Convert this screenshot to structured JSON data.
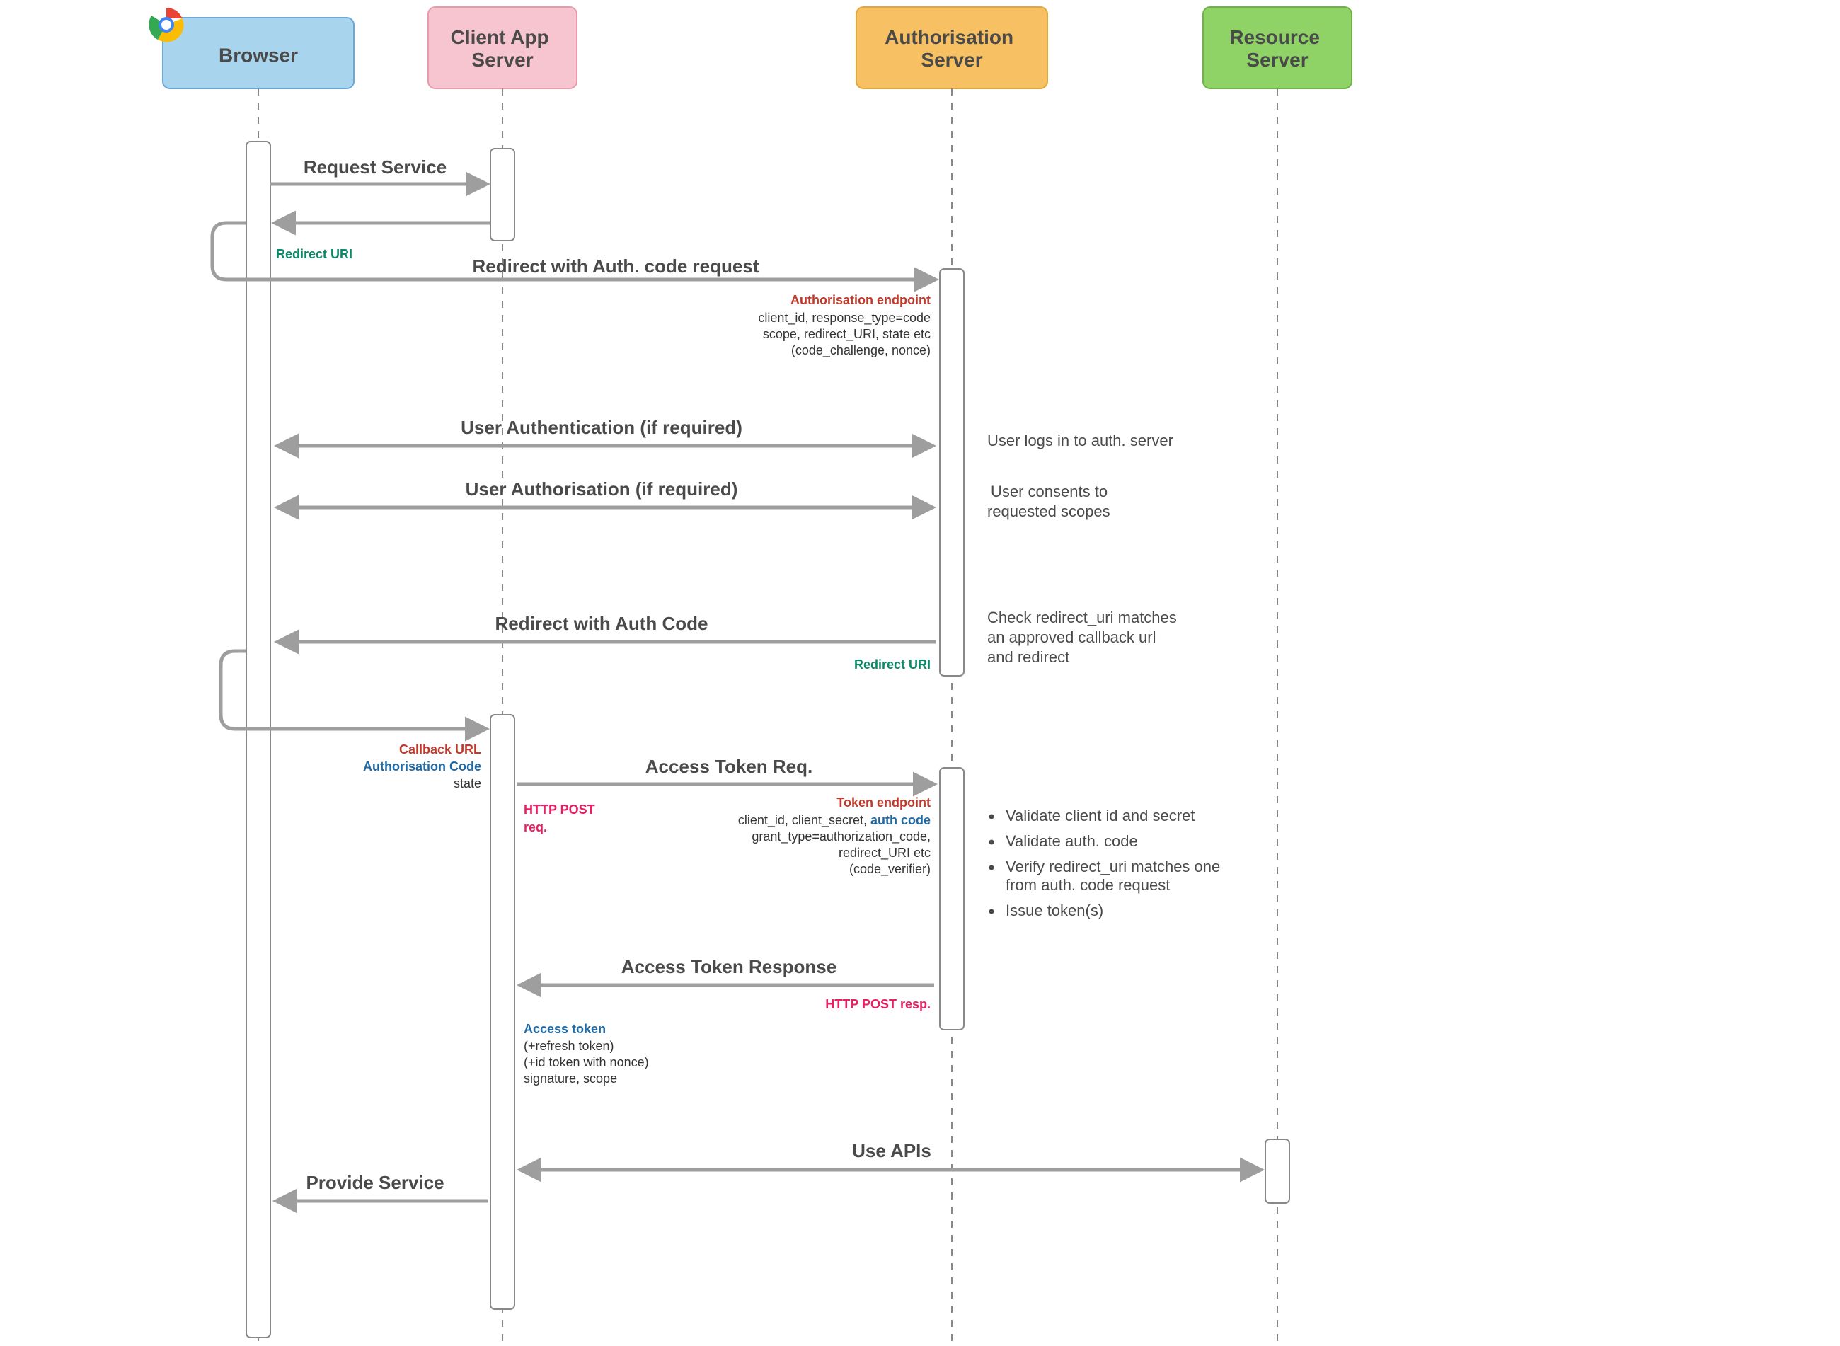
{
  "actors": {
    "browser": {
      "label": "Browser",
      "fill": "#a9d4ee",
      "stroke": "#6aa8d8"
    },
    "client": {
      "label": "Client App\nServer",
      "fill": "#f7c5cf",
      "stroke": "#e79aac"
    },
    "auth": {
      "label": "Authorisation\nServer",
      "fill": "#f6c063",
      "stroke": "#e0a83c"
    },
    "resource": {
      "label": "Resource\nServer",
      "fill": "#8fd367",
      "stroke": "#6fb347"
    }
  },
  "messages": {
    "request_service": "Request Service",
    "redirect_uri_label_1": "Redirect URI",
    "redirect_auth_code_req": "Redirect with Auth. code request",
    "auth_endpoint_title": "Authorisation endpoint",
    "auth_endpoint_l1": "client_id, response_type=code",
    "auth_endpoint_l2": "scope, redirect_URI, state etc",
    "auth_endpoint_l3": "(code_challenge, nonce)",
    "user_authn": "User Authentication (if required)",
    "user_authn_note": "User logs in to auth. server",
    "user_authz": "User Authorisation (if required)",
    "user_authz_note_l1": "User consents to",
    "user_authz_note_l2": "requested scopes",
    "redirect_with_code": "Redirect with Auth Code",
    "redirect_uri_label_2": "Redirect URI",
    "redirect_note_l1": "Check redirect_uri matches",
    "redirect_note_l2": "an approved callback url",
    "redirect_note_l3": "and redirect",
    "callback_url": "Callback URL",
    "authz_code": "Authorisation Code",
    "state_label": "state",
    "access_token_req": "Access Token Req.",
    "http_post_req_l1": "HTTP POST",
    "http_post_req_l2": "req.",
    "token_endpoint_title": "Token endpoint",
    "token_endpoint_l1a": "client_id, client_secret, ",
    "token_endpoint_l1b": "auth code",
    "token_endpoint_l2": "grant_type=authorization_code,",
    "token_endpoint_l3": "redirect_URI etc",
    "token_endpoint_l4": "(code_verifier)",
    "validate_bullets": [
      "Validate client id and secret",
      "Validate auth. code",
      "Verify redirect_uri matches one from auth. code request",
      "Issue token(s)"
    ],
    "access_token_resp": "Access Token Response",
    "http_post_resp": "HTTP POST resp.",
    "access_token_label": "Access token",
    "resp_l1": "(+refresh token)",
    "resp_l2": "(+id token with nonce)",
    "resp_l3": "signature, scope",
    "use_apis": "Use APIs",
    "provide_service": "Provide Service"
  },
  "chart_data": {
    "type": "table",
    "description": "UML-style sequence diagram of OAuth 2.0 Authorization Code flow",
    "lifelines": [
      "Browser",
      "Client App Server",
      "Authorisation Server",
      "Resource Server"
    ],
    "interactions": [
      {
        "from": "Browser",
        "to": "Client App Server",
        "label": "Request Service",
        "dir": "->"
      },
      {
        "from": "Client App Server",
        "to": "Browser",
        "label": "(response)",
        "dir": "->"
      },
      {
        "from": "Browser",
        "to": "Authorisation Server",
        "label": "Redirect with Auth. code request",
        "dir": "->",
        "note": "Redirect URI; Authorisation endpoint: client_id, response_type=code, scope, redirect_URI, state etc (code_challenge, nonce)"
      },
      {
        "from": "Browser",
        "to": "Authorisation Server",
        "label": "User Authentication (if required)",
        "dir": "<->",
        "side_note": "User logs in to auth. server"
      },
      {
        "from": "Browser",
        "to": "Authorisation Server",
        "label": "User Authorisation (if required)",
        "dir": "<->",
        "side_note": "User consents to requested scopes"
      },
      {
        "from": "Authorisation Server",
        "to": "Browser",
        "label": "Redirect with Auth Code",
        "dir": "->",
        "note": "Redirect URI",
        "side_note": "Check redirect_uri matches an approved callback url and redirect"
      },
      {
        "from": "Browser",
        "to": "Client App Server",
        "label": "(callback)",
        "dir": "->",
        "note": "Callback URL; Authorisation Code; state"
      },
      {
        "from": "Client App Server",
        "to": "Authorisation Server",
        "label": "Access Token Req.",
        "dir": "->",
        "note": "HTTP POST req.; Token endpoint: client_id, client_secret, auth code, grant_type=authorization_code, redirect_URI etc (code_verifier)",
        "side_note": "Validate client id and secret; Validate auth. code; Verify redirect_uri matches one from auth. code request; Issue token(s)"
      },
      {
        "from": "Authorisation Server",
        "to": "Client App Server",
        "label": "Access Token Response",
        "dir": "->",
        "note": "HTTP POST resp.; Access token (+refresh token) (+id token with nonce) signature, scope"
      },
      {
        "from": "Client App Server",
        "to": "Resource Server",
        "label": "Use APIs",
        "dir": "<->"
      },
      {
        "from": "Client App Server",
        "to": "Browser",
        "label": "Provide Service",
        "dir": "->"
      }
    ]
  }
}
